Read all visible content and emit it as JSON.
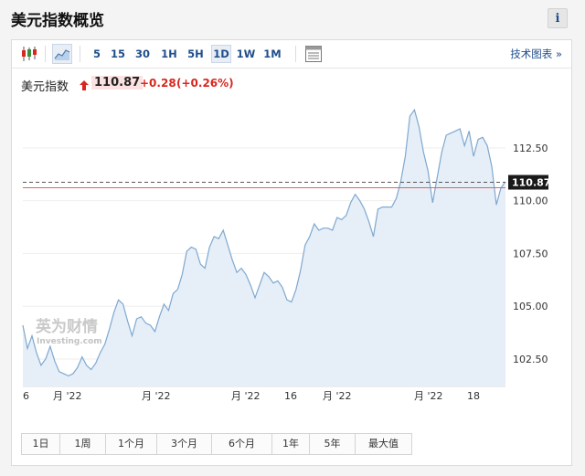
{
  "page": {
    "title": "美元指数概览",
    "info_icon": "i"
  },
  "toolbar": {
    "icons": [
      "candlestick-icon",
      "area-chart-icon",
      "table-icon"
    ],
    "intervals": [
      "5",
      "15",
      "30",
      "1H",
      "5H",
      "1D",
      "1W",
      "1M"
    ],
    "active_interval": "1D",
    "tech_link": "技术图表 »"
  },
  "quote": {
    "name": "美元指数",
    "price": "110.87",
    "change": "+0.28",
    "change_pct": "(+0.26%)",
    "arrow": "up-arrow-icon",
    "up_color": "#d8271f"
  },
  "chart_data": {
    "type": "area",
    "y_ticks": [
      "102.50",
      "105.00",
      "107.50",
      "110.00",
      "112.50"
    ],
    "x_ticks": [
      "6",
      "月 '22",
      "月 '22",
      "月 '22",
      "16",
      "月 '22",
      "月 '22",
      "18"
    ],
    "last_value_label": "110.87",
    "ylim": [
      101.2,
      114.7
    ],
    "y": [
      104.1,
      103.0,
      103.6,
      102.8,
      102.2,
      102.5,
      103.1,
      102.4,
      101.9,
      101.8,
      101.7,
      101.8,
      102.1,
      102.6,
      102.2,
      102.0,
      102.3,
      102.8,
      103.2,
      103.9,
      104.7,
      105.3,
      105.1,
      104.3,
      103.6,
      104.4,
      104.5,
      104.2,
      104.1,
      103.8,
      104.5,
      105.1,
      104.8,
      105.6,
      105.8,
      106.5,
      107.6,
      107.8,
      107.7,
      107.0,
      106.8,
      107.8,
      108.3,
      108.2,
      108.6,
      107.9,
      107.2,
      106.6,
      106.8,
      106.5,
      106.0,
      105.4,
      106.0,
      106.6,
      106.4,
      106.1,
      106.2,
      105.9,
      105.3,
      105.2,
      105.8,
      106.7,
      107.9,
      108.3,
      108.9,
      108.6,
      108.7,
      108.7,
      108.6,
      109.2,
      109.1,
      109.3,
      109.9,
      110.3,
      110.0,
      109.6,
      109.0,
      108.3,
      109.6,
      109.7,
      109.7,
      109.7,
      110.1,
      110.9,
      112.1,
      114.0,
      114.3,
      113.5,
      112.3,
      111.4,
      109.9,
      111.1,
      112.3,
      113.1,
      113.2,
      113.3,
      113.4,
      112.6,
      113.3,
      112.1,
      112.9,
      113.0,
      112.6,
      111.6,
      109.8,
      110.6,
      110.9
    ],
    "lines": {
      "price_line": "110.87",
      "previous_close_color": "#e06060"
    },
    "colors": {
      "line": "#7ea8cf",
      "fill": "#e6eff8",
      "grid": "#eeeeee",
      "last_label_bg": "#1a1a1a"
    }
  },
  "watermark": {
    "brand_cn": "英为财情",
    "brand_en": "Investing.com"
  },
  "ranges": {
    "items": [
      "1日",
      "1周",
      "1个月",
      "3个月",
      "6个月",
      "1年",
      "5年",
      "最大值"
    ]
  }
}
